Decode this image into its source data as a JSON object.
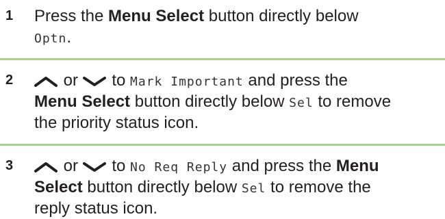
{
  "steps": [
    {
      "number": "1",
      "line1": {
        "t1": "Press the ",
        "b1": "Menu Select",
        "t2": " button directly below"
      },
      "line2": {
        "code": "Optn",
        "t": "."
      }
    },
    {
      "number": "2",
      "line1": {
        "or": " or ",
        "t1": " to ",
        "code": "Mark Important",
        "t2": " and press the"
      },
      "line2": {
        "b1": "Menu Select",
        "t1": " button directly below ",
        "code": "Sel",
        "t2": " to remove"
      },
      "line3": {
        "t": "the priority status icon."
      }
    },
    {
      "number": "3",
      "line1": {
        "or": " or ",
        "t1": " to ",
        "code": "No Req Reply",
        "t2": " and press the ",
        "b1": "Menu"
      },
      "line2": {
        "b1": "Select",
        "t1": " button directly below ",
        "code": "Sel",
        "t2": " to remove the"
      },
      "line3": {
        "t": "reply status icon."
      }
    }
  ],
  "icons": {
    "up": "up-arrow-icon",
    "down": "down-arrow-icon"
  },
  "colors": {
    "divider": "#a9cf8f",
    "text": "#231f20"
  }
}
